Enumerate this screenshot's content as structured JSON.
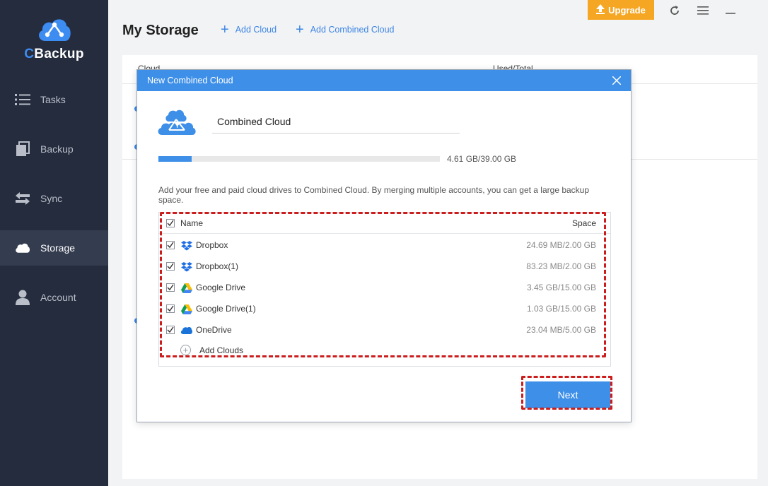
{
  "app": {
    "name_first": "C",
    "name_rest": "Backup",
    "accent": "#3d8cf2"
  },
  "sidebar": {
    "items": [
      {
        "label": "Tasks",
        "icon": "list-icon"
      },
      {
        "label": "Backup",
        "icon": "copy-icon"
      },
      {
        "label": "Sync",
        "icon": "sync-arrows-icon"
      },
      {
        "label": "Storage",
        "icon": "cloud-icon",
        "active": true
      },
      {
        "label": "Account",
        "icon": "user-icon"
      }
    ]
  },
  "header": {
    "title": "My Storage",
    "add_cloud": "Add Cloud",
    "add_combined_cloud": "Add Combined Cloud",
    "upgrade": "Upgrade"
  },
  "background_table": {
    "col_cloud": "Cloud",
    "col_used": "Used/Total"
  },
  "dialog": {
    "title": "New Combined Cloud",
    "name_value": "Combined Cloud",
    "usage": "4.61 GB/39.00 GB",
    "usage_fraction": 0.118,
    "description": "Add your free and paid cloud drives to Combined Cloud. By merging multiple accounts, you can get a large backup space.",
    "list": {
      "col_name": "Name",
      "col_space": "Space",
      "rows": [
        {
          "name": "Dropbox",
          "space": "24.69 MB/2.00 GB",
          "icon": "dropbox-icon"
        },
        {
          "name": "Dropbox(1)",
          "space": "83.23 MB/2.00 GB",
          "icon": "dropbox-icon"
        },
        {
          "name": "Google Drive",
          "space": "3.45 GB/15.00 GB",
          "icon": "google-drive-icon"
        },
        {
          "name": "Google Drive(1)",
          "space": "1.03 GB/15.00 GB",
          "icon": "google-drive-icon"
        },
        {
          "name": "OneDrive",
          "space": "23.04 MB/5.00 GB",
          "icon": "onedrive-icon"
        }
      ],
      "add_clouds": "Add Clouds"
    },
    "next": "Next"
  }
}
